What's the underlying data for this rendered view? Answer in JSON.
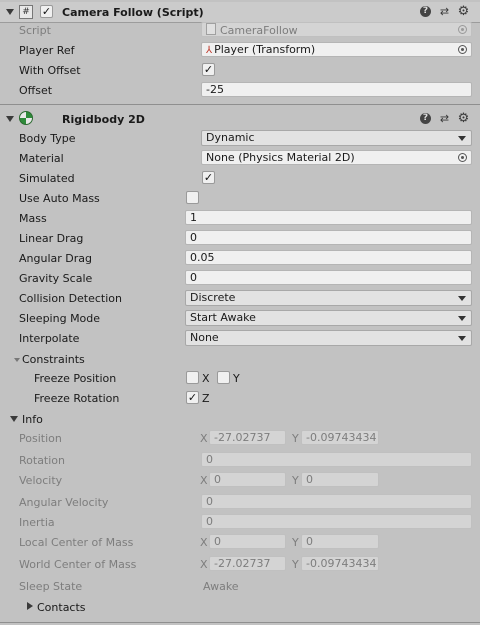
{
  "camera_follow": {
    "title": "Camera Follow (Script)",
    "enabled": true,
    "script_label": "Script",
    "script_value": "CameraFollow",
    "player_ref_label": "Player Ref",
    "player_ref_value": "Player (Transform)",
    "with_offset_label": "With Offset",
    "with_offset_checked": true,
    "offset_label": "Offset",
    "offset_value": "-25"
  },
  "rigidbody": {
    "title": "Rigidbody 2D",
    "body_type_label": "Body Type",
    "body_type_value": "Dynamic",
    "material_label": "Material",
    "material_value": "None (Physics Material 2D)",
    "simulated_label": "Simulated",
    "use_auto_mass_label": "Use Auto Mass",
    "mass_label": "Mass",
    "mass_value": "1",
    "linear_drag_label": "Linear Drag",
    "linear_drag_value": "0",
    "angular_drag_label": "Angular Drag",
    "angular_drag_value": "0.05",
    "gravity_scale_label": "Gravity Scale",
    "gravity_scale_value": "0",
    "collision_detection_label": "Collision Detection",
    "collision_detection_value": "Discrete",
    "sleeping_mode_label": "Sleeping Mode",
    "sleeping_mode_value": "Start Awake",
    "interpolate_label": "Interpolate",
    "interpolate_value": "None",
    "constraints_label": "Constraints",
    "freeze_position_label": "Freeze Position",
    "freeze_rotation_label": "Freeze Rotation",
    "axis_x": "X",
    "axis_y": "Y",
    "axis_z": "Z"
  },
  "info": {
    "label": "Info",
    "position_label": "Position",
    "position_x": "-27.02737",
    "position_y": "-0.09743434",
    "rotation_label": "Rotation",
    "rotation_value": "0",
    "velocity_label": "Velocity",
    "velocity_x": "0",
    "velocity_y": "0",
    "angular_velocity_label": "Angular Velocity",
    "angular_velocity_value": "0",
    "inertia_label": "Inertia",
    "inertia_value": "0",
    "local_com_label": "Local Center of Mass",
    "local_com_x": "0",
    "local_com_y": "0",
    "world_com_label": "World Center of Mass",
    "world_com_x": "-27.02737",
    "world_com_y": "-0.09743434",
    "sleep_state_label": "Sleep State",
    "sleep_state_value": "Awake",
    "contacts_label": "Contacts"
  },
  "icons": {
    "help": "?",
    "presets": "⇄",
    "settings": "⚙",
    "check": "✓",
    "script": "#"
  }
}
